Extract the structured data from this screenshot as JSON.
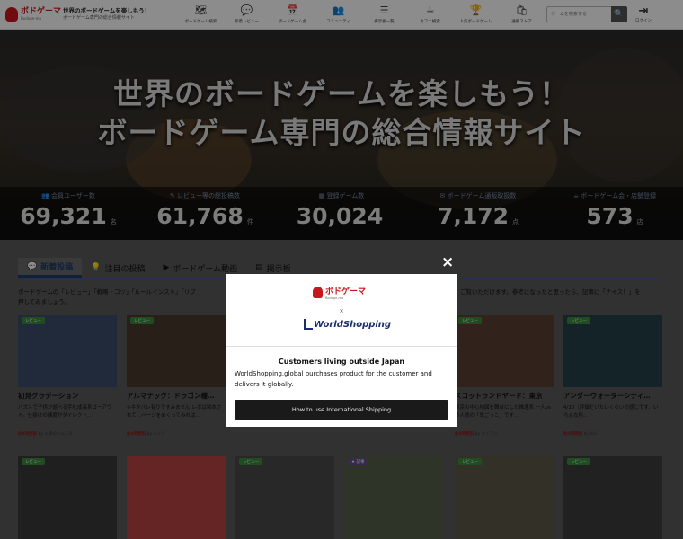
{
  "header": {
    "logo_text": "ボドゲーマ",
    "logo_sub": "Bodoge-ma",
    "tagline_1": "世界のボードゲームを楽しもう！",
    "tagline_2": "ボードゲーム専門の総合情報サイト",
    "nav": [
      {
        "icon": "map-icon",
        "glyph": "🗺",
        "label": "ボードゲーム検索"
      },
      {
        "icon": "chat-icon",
        "glyph": "💬",
        "label": "新着レビュー"
      },
      {
        "icon": "calendar-icon",
        "glyph": "📅",
        "label": "ボードゲーム会"
      },
      {
        "icon": "community-icon",
        "glyph": "👥",
        "label": "コミュニティ"
      },
      {
        "icon": "list-icon",
        "glyph": "☰",
        "label": "掲示板一覧"
      },
      {
        "icon": "cafe-icon",
        "glyph": "☕",
        "label": "カフェ検索"
      },
      {
        "icon": "trophy-icon",
        "glyph": "🏆",
        "label": "人気ボードゲーム"
      },
      {
        "icon": "shop-icon",
        "glyph": "🛍",
        "label": "通販ストア"
      }
    ],
    "search_placeholder": "ゲームを検索する",
    "search_glyph": "🔍",
    "login_glyph": "⇥",
    "login_label": "ログイン"
  },
  "hero": {
    "title_1": "世界のボードゲームを楽しもう！",
    "title_2": "ボードゲーム専門の総合情報サイト",
    "stats": [
      {
        "label": "👥 会員ユーザー数",
        "value": "69,321",
        "unit": "名"
      },
      {
        "label": "✎ レビュー等の総投稿数",
        "value": "61,768",
        "unit": "件"
      },
      {
        "label": "▦ 登録ゲーム数",
        "value": "30,024",
        "unit": ""
      },
      {
        "label": "✉ ボードゲーム通販取扱数",
        "value": "7,172",
        "unit": "点"
      },
      {
        "label": "☕ ボードゲーム会・店舗登録",
        "value": "573",
        "unit": "店"
      }
    ]
  },
  "tabs": [
    {
      "icon": "chat-icon",
      "glyph": "💬",
      "label": "新着投稿",
      "active": true
    },
    {
      "icon": "lightbulb-icon",
      "glyph": "💡",
      "label": "注目の投稿",
      "active": false
    },
    {
      "icon": "video-icon",
      "glyph": "▶",
      "label": "ボードゲーム動画",
      "active": false
    },
    {
      "icon": "board-icon",
      "glyph": "▤",
      "label": "掲示板",
      "active": false
    }
  ],
  "intro": {
    "left": "ボードゲームの「レビュー」「戦略・コツ」「ルールインスト」「リプ",
    "right": "ご覧いただけます。参考になったと思ったら、記事に「ナイス！」を",
    "line2": "押してみましょう。"
  },
  "cards": [
    {
      "badge": "レビュー",
      "title": "初見グラデーション",
      "desc": "パズルで子供が遊べる手札成長系ゴーアウト。仕掛けの練度がダイレクト…",
      "meta": "約4時間前",
      "by": "by 人狼のハムスタ",
      "img": "#3c4e6a"
    },
    {
      "badge": "レビュー",
      "title": "アルマナック：ドラゴン種…",
      "desc": "※ネタバレ有りですみません レポは製本されて…ページをめくってみれば…",
      "meta": "約4時間前",
      "by": "by ハイド",
      "img": "#4a3a2c"
    },
    {
      "badge": "",
      "title": "",
      "desc": "",
      "meta": "",
      "by": "",
      "img": "#2e2e2e"
    },
    {
      "badge": "",
      "title": "",
      "desc": "",
      "meta": "",
      "by": "",
      "img": "#2e2e2e"
    },
    {
      "badge": "レビュー",
      "title": "スコットランドヤード：東京",
      "desc": "東京の中心地図を舞台にした推理系 一人vs多人数の「鬼ごっこ」です…",
      "meta": "約4時間前",
      "by": "by ダイアン",
      "img": "#5a3e32"
    },
    {
      "badge": "レビュー",
      "title": "アンダーウォーターシティ…",
      "desc": "4/10（評価だいたいくらいの感じです、いろんな所…",
      "meta": "約4時間前",
      "by": "by Kiri",
      "img": "#26414a"
    }
  ],
  "cards_row2": [
    {
      "badge": "レビュー",
      "purple": false,
      "img": "#3a3a3a"
    },
    {
      "badge": "",
      "purple": false,
      "img": "#b84444"
    },
    {
      "badge": "レビュー",
      "purple": false,
      "img": "#4a4a4a"
    },
    {
      "badge": "★ 記事",
      "purple": true,
      "img": "#556048"
    },
    {
      "badge": "レビュー",
      "purple": false,
      "img": "#5e5a48"
    },
    {
      "badge": "レビュー",
      "purple": false,
      "img": "#3c3c3c"
    }
  ],
  "modal": {
    "close_glyph": "×",
    "logo_text": "ボドゲーマ",
    "logo_sub": "Bodoge-ma",
    "times": "×",
    "ws_text": "WorldShopping",
    "heading": "Customers living outside Japan",
    "body": "WorldShopping.global purchases product for the customer and delivers it globally.",
    "button": "How to use International Shipping"
  }
}
